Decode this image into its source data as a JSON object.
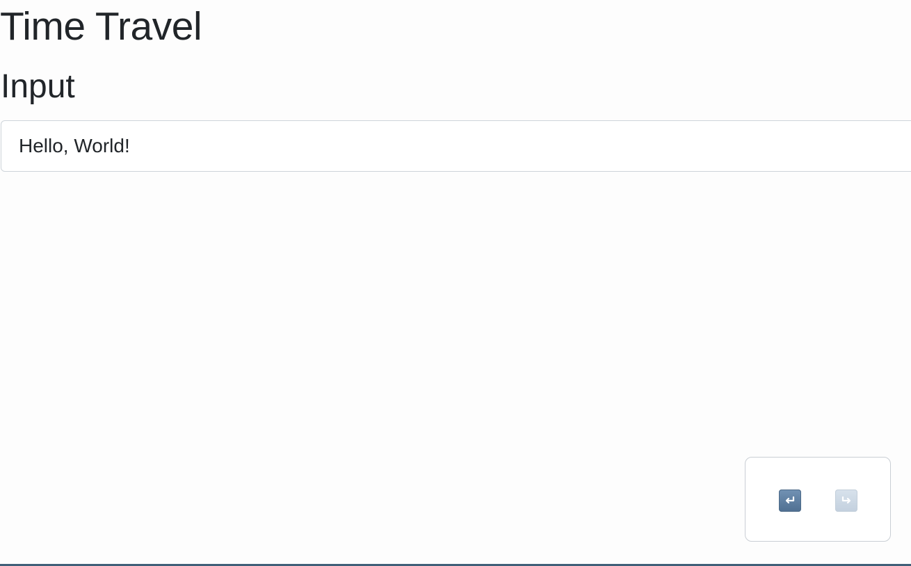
{
  "header": {
    "title": "Time Travel"
  },
  "section": {
    "title": "Input"
  },
  "input": {
    "value": "Hello, World!"
  },
  "history_controls": {
    "undo": {
      "icon": "undo-icon",
      "enabled": true,
      "color": "#5f7fa1"
    },
    "redo": {
      "icon": "redo-icon",
      "enabled": false,
      "color": "#cfdae6"
    }
  }
}
